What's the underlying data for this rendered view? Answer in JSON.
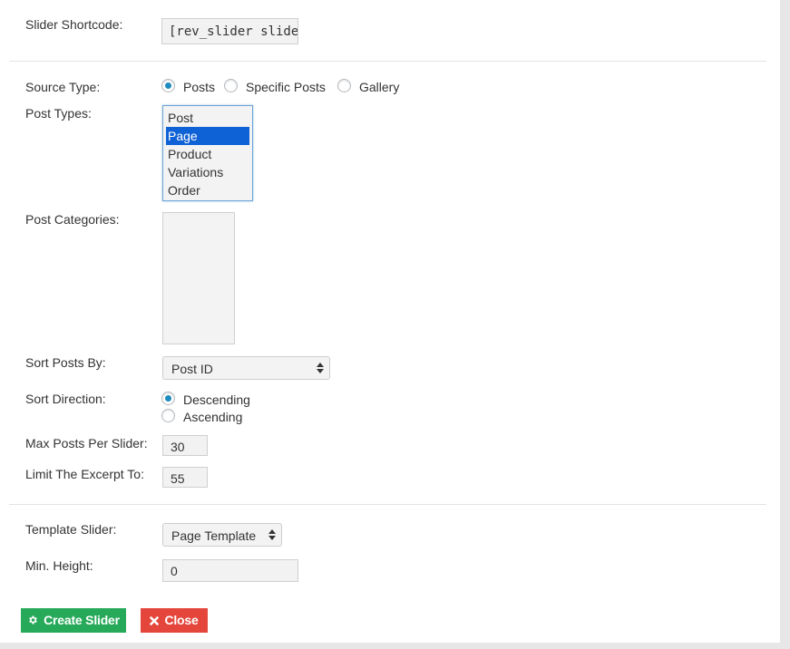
{
  "form": {
    "slider_shortcode": {
      "label": "Slider Shortcode:",
      "value": "[rev_slider slide"
    },
    "source_type": {
      "label": "Source Type:",
      "options": [
        "Posts",
        "Specific Posts",
        "Gallery"
      ],
      "selected": "Posts"
    },
    "post_types": {
      "label": "Post Types:",
      "options": [
        "Post",
        "Page",
        "Product",
        "Variations",
        "Order"
      ],
      "selected": "Page"
    },
    "post_categories": {
      "label": "Post Categories:"
    },
    "sort_posts_by": {
      "label": "Sort Posts By:",
      "value": "Post ID"
    },
    "sort_direction": {
      "label": "Sort Direction:",
      "options": [
        "Descending",
        "Ascending"
      ],
      "selected": "Descending"
    },
    "max_posts": {
      "label": "Max Posts Per Slider:",
      "value": "30"
    },
    "excerpt_limit": {
      "label": "Limit The Excerpt To:",
      "value": "55"
    },
    "template_slider": {
      "label": "Template Slider:",
      "value": "Page Template"
    },
    "min_height": {
      "label": "Min. Height:",
      "value": "0"
    }
  },
  "buttons": {
    "create_label": "Create Slider",
    "create_icon": "gear-icon",
    "close_label": "Close",
    "close_icon": "x-icon"
  },
  "colors": {
    "create_button": "#27a95a",
    "close_button": "#e5463c",
    "selected_option": "#0f62d6",
    "radio_dot": "#1e8cbe"
  }
}
